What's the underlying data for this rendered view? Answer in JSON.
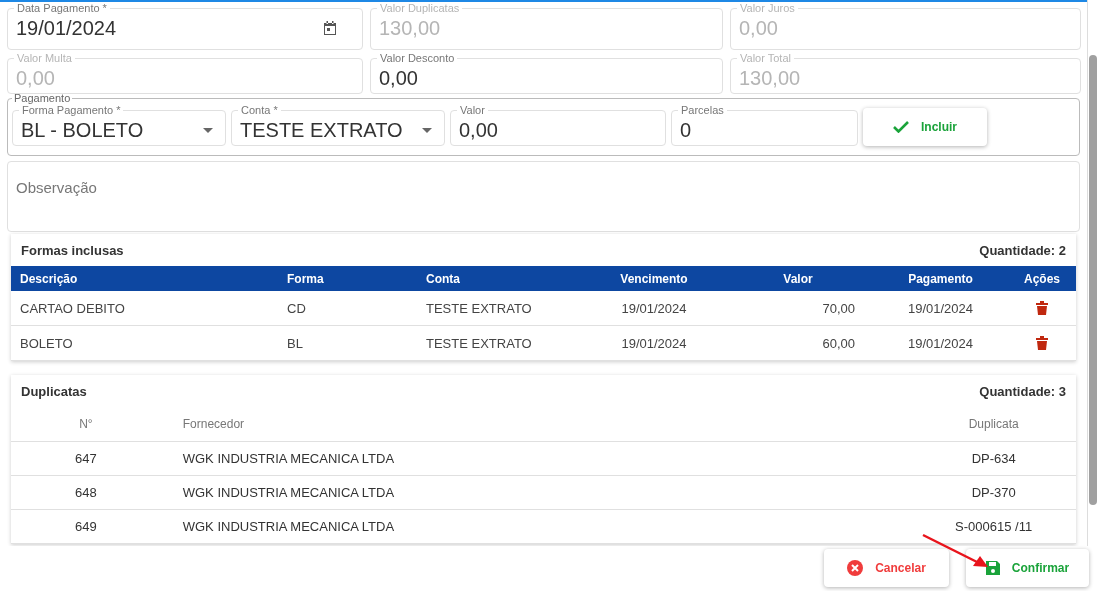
{
  "fields_top": [
    {
      "label": "Data Pagamento *",
      "value": "19/01/2024",
      "kind": "date",
      "disabled": false
    },
    {
      "label": "Valor Duplicatas",
      "value": "130,00",
      "kind": "text",
      "disabled": true
    },
    {
      "label": "Valor Juros",
      "value": "0,00",
      "kind": "text",
      "disabled": true
    },
    {
      "label": "Valor Multa",
      "value": "0,00",
      "kind": "text",
      "disabled": true
    },
    {
      "label": "Valor Desconto",
      "value": "0,00",
      "kind": "text",
      "disabled": false
    },
    {
      "label": "Valor Total",
      "value": "130,00",
      "kind": "text",
      "disabled": true
    }
  ],
  "pagamento": {
    "legend": "Pagamento",
    "fields": [
      {
        "label": "Forma Pagamento *",
        "value": "BL - BOLETO",
        "kind": "select"
      },
      {
        "label": "Conta *",
        "value": "TESTE EXTRATO",
        "kind": "select"
      },
      {
        "label": "Valor",
        "value": "0,00",
        "kind": "text"
      },
      {
        "label": "Parcelas",
        "value": "0",
        "kind": "text"
      }
    ],
    "button": "Incluir"
  },
  "observacao": {
    "placeholder": "Observação"
  },
  "formas": {
    "title": "Formas inclusas",
    "count": "Quantidade: 2",
    "columns": [
      "Descrição",
      "Forma",
      "Conta",
      "Vencimento",
      "Valor",
      "Pagamento",
      "Ações"
    ],
    "rows": [
      [
        "CARTAO DEBITO",
        "CD",
        "TESTE EXTRATO",
        "19/01/2024",
        "70,00",
        "19/01/2024"
      ],
      [
        "BOLETO",
        "BL",
        "TESTE EXTRATO",
        "19/01/2024",
        "60,00",
        "19/01/2024"
      ]
    ]
  },
  "duplicatas": {
    "title": "Duplicatas",
    "count": "Quantidade: 3",
    "columns": [
      "N°",
      "Fornecedor",
      "Duplicata"
    ],
    "rows": [
      [
        "647",
        "WGK INDUSTRIA MECANICA LTDA",
        "DP-634"
      ],
      [
        "648",
        "WGK INDUSTRIA MECANICA LTDA",
        "DP-370"
      ],
      [
        "649",
        "WGK INDUSTRIA MECANICA LTDA",
        "S-000615 /11"
      ]
    ]
  },
  "footer": {
    "cancel": "Cancelar",
    "confirm": "Confirmar"
  }
}
